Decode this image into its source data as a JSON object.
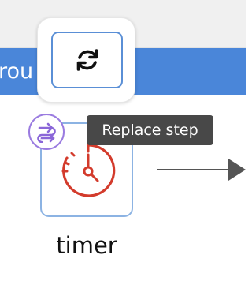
{
  "route_bar": {
    "label": "rou",
    "color": "#4a86d9"
  },
  "popover": {
    "action_icon": "refresh-icon",
    "accent": "#5a8fd6"
  },
  "tooltip": {
    "text": "Replace step"
  },
  "step": {
    "label": "timer",
    "icon": "timer-icon",
    "icon_color": "#d33b2c",
    "badge_icon": "swap-route-icon",
    "badge_color": "#9a7be0"
  }
}
